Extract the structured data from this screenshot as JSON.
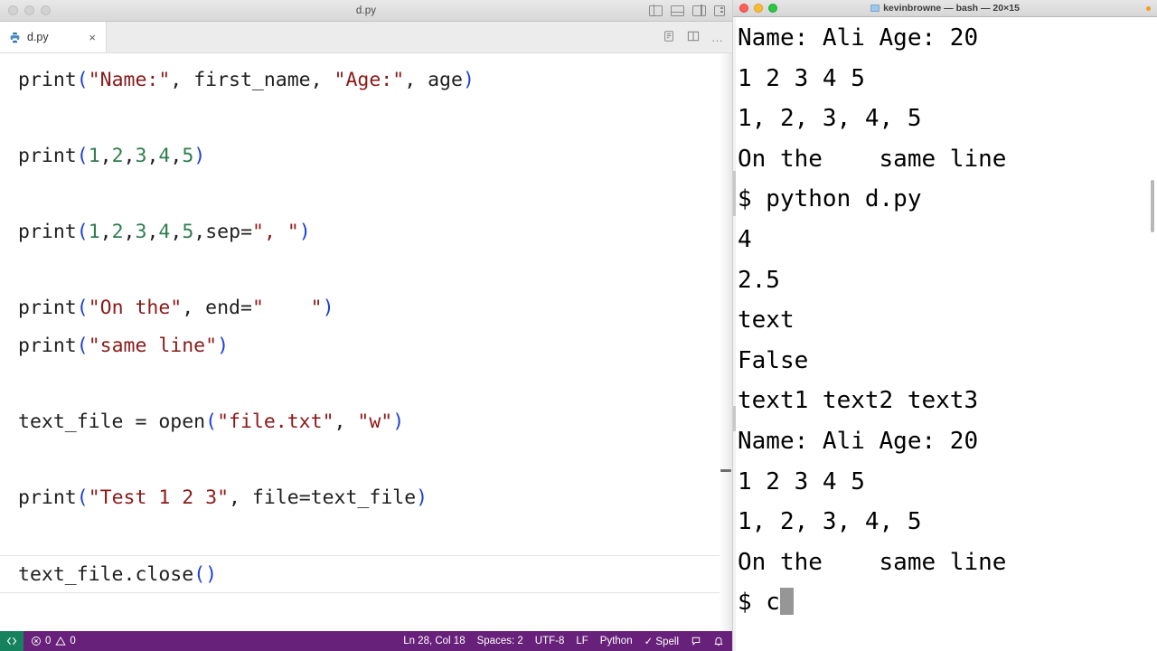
{
  "vscode": {
    "window_title": "d.py",
    "traffic_lights": [
      "close",
      "minimize",
      "zoom"
    ],
    "layout_icons": [
      "toggle-primary-sidebar",
      "toggle-panel",
      "toggle-secondary-sidebar",
      "customize-layout"
    ],
    "tab": {
      "label": "d.py",
      "icon": "python-file-icon",
      "close_label": "×"
    },
    "tab_actions": {
      "split_preview_label": "⎘",
      "split_editor_label": "▥",
      "more_label": "…"
    },
    "editor": {
      "lines": [
        {
          "current": false,
          "tokens": [
            {
              "t": "print",
              "c": "fn"
            },
            {
              "t": "(",
              "c": "par"
            },
            {
              "t": "\"Name:\"",
              "c": "str"
            },
            {
              "t": ", ",
              "c": "id"
            },
            {
              "t": "first_name",
              "c": "id"
            },
            {
              "t": ", ",
              "c": "id"
            },
            {
              "t": "\"Age:\"",
              "c": "str"
            },
            {
              "t": ", ",
              "c": "id"
            },
            {
              "t": "age",
              "c": "id"
            },
            {
              "t": ")",
              "c": "par"
            }
          ]
        },
        {
          "current": false,
          "tokens": []
        },
        {
          "current": false,
          "tokens": [
            {
              "t": "print",
              "c": "fn"
            },
            {
              "t": "(",
              "c": "par"
            },
            {
              "t": "1",
              "c": "num"
            },
            {
              "t": ",",
              "c": "id"
            },
            {
              "t": "2",
              "c": "num"
            },
            {
              "t": ",",
              "c": "id"
            },
            {
              "t": "3",
              "c": "num"
            },
            {
              "t": ",",
              "c": "id"
            },
            {
              "t": "4",
              "c": "num"
            },
            {
              "t": ",",
              "c": "id"
            },
            {
              "t": "5",
              "c": "num"
            },
            {
              "t": ")",
              "c": "par"
            }
          ]
        },
        {
          "current": false,
          "tokens": []
        },
        {
          "current": false,
          "tokens": [
            {
              "t": "print",
              "c": "fn"
            },
            {
              "t": "(",
              "c": "par"
            },
            {
              "t": "1",
              "c": "num"
            },
            {
              "t": ",",
              "c": "id"
            },
            {
              "t": "2",
              "c": "num"
            },
            {
              "t": ",",
              "c": "id"
            },
            {
              "t": "3",
              "c": "num"
            },
            {
              "t": ",",
              "c": "id"
            },
            {
              "t": "4",
              "c": "num"
            },
            {
              "t": ",",
              "c": "id"
            },
            {
              "t": "5",
              "c": "num"
            },
            {
              "t": ",",
              "c": "id"
            },
            {
              "t": "sep",
              "c": "id"
            },
            {
              "t": "=",
              "c": "id"
            },
            {
              "t": "\", \"",
              "c": "str"
            },
            {
              "t": ")",
              "c": "par"
            }
          ]
        },
        {
          "current": false,
          "tokens": []
        },
        {
          "current": false,
          "tokens": [
            {
              "t": "print",
              "c": "fn"
            },
            {
              "t": "(",
              "c": "par"
            },
            {
              "t": "\"On the\"",
              "c": "str"
            },
            {
              "t": ", ",
              "c": "id"
            },
            {
              "t": "end",
              "c": "id"
            },
            {
              "t": "=",
              "c": "id"
            },
            {
              "t": "\"    \"",
              "c": "str"
            },
            {
              "t": ")",
              "c": "par"
            }
          ]
        },
        {
          "current": false,
          "tokens": [
            {
              "t": "print",
              "c": "fn"
            },
            {
              "t": "(",
              "c": "par"
            },
            {
              "t": "\"same line\"",
              "c": "str"
            },
            {
              "t": ")",
              "c": "par"
            }
          ]
        },
        {
          "current": false,
          "tokens": []
        },
        {
          "current": false,
          "tokens": [
            {
              "t": "text_file",
              "c": "id"
            },
            {
              "t": " = ",
              "c": "id"
            },
            {
              "t": "open",
              "c": "fn"
            },
            {
              "t": "(",
              "c": "par"
            },
            {
              "t": "\"file.txt\"",
              "c": "str"
            },
            {
              "t": ", ",
              "c": "id"
            },
            {
              "t": "\"w\"",
              "c": "str"
            },
            {
              "t": ")",
              "c": "par"
            }
          ]
        },
        {
          "current": false,
          "tokens": []
        },
        {
          "current": false,
          "tokens": [
            {
              "t": "print",
              "c": "fn"
            },
            {
              "t": "(",
              "c": "par"
            },
            {
              "t": "\"Test 1 2 3\"",
              "c": "str"
            },
            {
              "t": ", ",
              "c": "id"
            },
            {
              "t": "file",
              "c": "id"
            },
            {
              "t": "=",
              "c": "id"
            },
            {
              "t": "text_file",
              "c": "id"
            },
            {
              "t": ")",
              "c": "par"
            }
          ]
        },
        {
          "current": false,
          "tokens": []
        },
        {
          "current": true,
          "tokens": [
            {
              "t": "text_file",
              "c": "id"
            },
            {
              "t": ".",
              "c": "id"
            },
            {
              "t": "close",
              "c": "fn"
            },
            {
              "t": "(",
              "c": "par"
            },
            {
              "t": ")",
              "c": "par"
            }
          ]
        }
      ]
    },
    "status_bar": {
      "remote_label": "><",
      "errors_icon": "error-circle-icon",
      "errors": "0",
      "warnings_icon": "warning-triangle-icon",
      "warnings": "0",
      "cursor_position": "Ln 28, Col 18",
      "indentation": "Spaces: 2",
      "encoding": "UTF-8",
      "eol": "LF",
      "language": "Python",
      "spell": "✓ Spell",
      "feedback_icon": "feedback-icon",
      "bell_icon": "bell-icon",
      "accent_color": "#68217a",
      "remote_color": "#16825d"
    }
  },
  "terminal": {
    "title": "kevinbrowne — bash — 20×15",
    "folder_icon": "folder-icon",
    "traffic_lights": [
      "close",
      "minimize",
      "zoom"
    ],
    "lines": [
      "Name: Ali Age: 20",
      "1 2 3 4 5",
      "1, 2, 3, 4, 5",
      "On the    same line",
      "$ python d.py",
      "4",
      "2.5",
      "text",
      "False",
      "text1 text2 text3",
      "Name: Ali Age: 20",
      "1 2 3 4 5",
      "1, 2, 3, 4, 5",
      "On the    same line"
    ],
    "prompt": "$ c",
    "cursor": "block-cursor"
  }
}
